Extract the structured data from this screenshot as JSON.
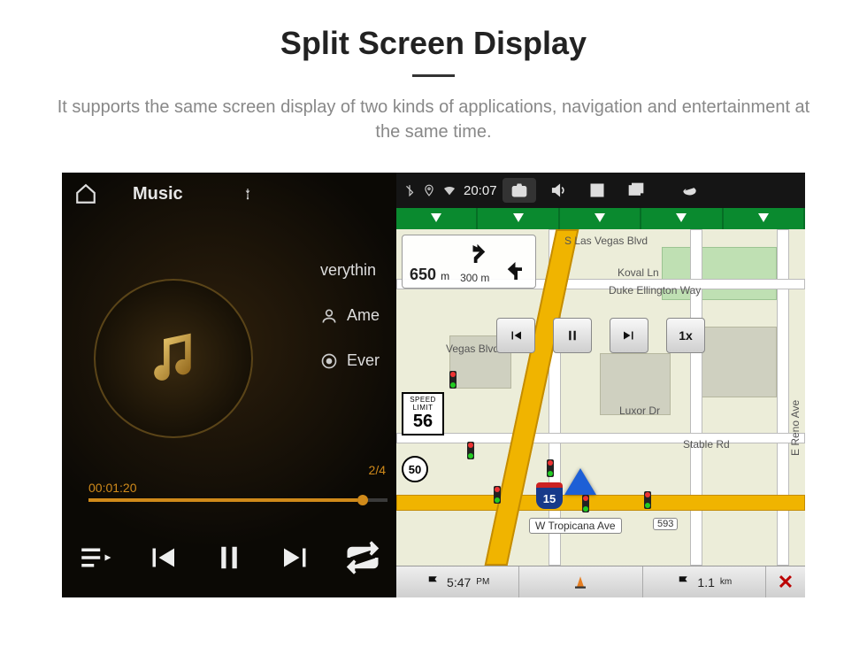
{
  "header": {
    "title": "Split Screen Display",
    "subtitle": "It supports the same screen display of two kinds of applications, navigation and entertainment at the same time."
  },
  "music": {
    "title": "Music",
    "track1": "verythin",
    "track2": "Ame",
    "track3": "Ever",
    "counter": "2/4",
    "time": "00:01:20"
  },
  "statusbar": {
    "time": "20:07"
  },
  "turn": {
    "dist_primary": "650",
    "dist_primary_unit": "m",
    "dist_secondary": "300 m"
  },
  "speed_limit": {
    "label": "SPEED LIMIT",
    "value": "56"
  },
  "streets": {
    "s_las_vegas": "S Las Vegas Blvd",
    "koval": "Koval Ln",
    "duke": "Duke Ellington Way",
    "vegas_blvd": "Vegas Blvd",
    "luxor": "Luxor Dr",
    "stable": "Stable Rd",
    "reno": "E Reno Ave",
    "tropicana": "W Tropicana Ave",
    "tropicana_num": "593"
  },
  "media": {
    "speed": "1x"
  },
  "shields": {
    "i15": "15",
    "r50": "50"
  },
  "bottombar": {
    "eta": "5:47",
    "eta_unit": "PM",
    "dist": "1.1",
    "dist_unit": "km"
  }
}
